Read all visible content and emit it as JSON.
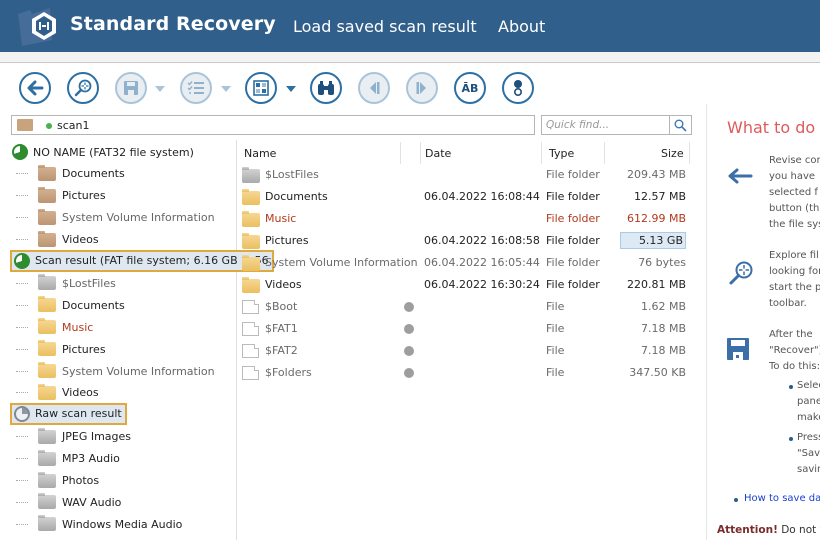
{
  "header": {
    "app_title": "Standard Recovery",
    "nav": [
      {
        "label": "Load saved scan result"
      },
      {
        "label": "About"
      }
    ]
  },
  "toolbar": {
    "buttons": [
      {
        "name": "back",
        "icon": "arrow-left-icon",
        "enabled": true
      },
      {
        "name": "scan",
        "icon": "magnifier-crosshair-icon",
        "enabled": true
      },
      {
        "name": "save",
        "icon": "floppy-disk-icon",
        "enabled": false,
        "has_dropdown": true
      },
      {
        "name": "checklist",
        "icon": "checklist-icon",
        "enabled": false,
        "has_dropdown": true
      },
      {
        "name": "view-mode",
        "icon": "grid-view-icon",
        "enabled": true,
        "has_dropdown": true
      },
      {
        "name": "find",
        "icon": "binoculars-icon",
        "enabled": true
      },
      {
        "name": "previous",
        "icon": "step-back-icon",
        "enabled": false
      },
      {
        "name": "next",
        "icon": "step-forward-icon",
        "enabled": false
      },
      {
        "name": "encoding",
        "icon": "charset-icon",
        "label": "ĀB",
        "enabled": true
      },
      {
        "name": "info",
        "icon": "info-icon",
        "enabled": true
      }
    ]
  },
  "path_bar": {
    "value": "scan1"
  },
  "search": {
    "placeholder": "Quick find..."
  },
  "tree": {
    "items": [
      {
        "label": "NO NAME (FAT32 file system)",
        "type": "root",
        "icon": "scan-pie-icon"
      },
      {
        "label": "Documents",
        "type": "folder",
        "color": "brown",
        "style": "normal"
      },
      {
        "label": "Pictures",
        "type": "folder",
        "color": "brown",
        "style": "normal"
      },
      {
        "label": "System Volume Information",
        "type": "folder",
        "color": "brown",
        "style": "muted"
      },
      {
        "label": "Videos",
        "type": "folder",
        "color": "brown",
        "style": "normal"
      },
      {
        "label": "Scan result (FAT file system; 6.16 GB in 56",
        "type": "root",
        "icon": "scan-pie-icon",
        "highlight": true
      },
      {
        "label": "$LostFiles",
        "type": "folder",
        "color": "grey",
        "style": "muted"
      },
      {
        "label": "Documents",
        "type": "folder",
        "color": "yellow",
        "style": "normal"
      },
      {
        "label": "Music",
        "type": "folder",
        "color": "yellow",
        "style": "red"
      },
      {
        "label": "Pictures",
        "type": "folder",
        "color": "yellow",
        "style": "normal"
      },
      {
        "label": "System Volume Information",
        "type": "folder",
        "color": "yellow",
        "style": "muted"
      },
      {
        "label": "Videos",
        "type": "folder",
        "color": "yellow",
        "style": "normal"
      },
      {
        "label": "Raw scan result",
        "type": "root",
        "icon": "raw-pie-icon",
        "highlight": true
      },
      {
        "label": "JPEG Images",
        "type": "folder",
        "color": "grey",
        "style": "normal"
      },
      {
        "label": "MP3 Audio",
        "type": "folder",
        "color": "grey",
        "style": "normal"
      },
      {
        "label": "Photos",
        "type": "folder",
        "color": "grey",
        "style": "normal"
      },
      {
        "label": "WAV Audio",
        "type": "folder",
        "color": "grey",
        "style": "normal"
      },
      {
        "label": "Windows Media Audio",
        "type": "folder",
        "color": "grey",
        "style": "normal"
      }
    ]
  },
  "file_list": {
    "columns": [
      "Name",
      "Date",
      "Type",
      "Size"
    ],
    "rows": [
      {
        "name": "$LostFiles",
        "date": "",
        "type": "File folder",
        "size": "209.43 MB",
        "kind": "folder-grey",
        "style": "muted"
      },
      {
        "name": "Documents",
        "date": "06.04.2022 16:08:44",
        "type": "File folder",
        "size": "12.57 MB",
        "kind": "folder",
        "style": "normal"
      },
      {
        "name": "Music",
        "date": "",
        "type": "File folder",
        "size": "612.99 MB",
        "kind": "folder",
        "style": "red"
      },
      {
        "name": "Pictures",
        "date": "06.04.2022 16:08:58",
        "type": "File folder",
        "size": "5.13 GB",
        "kind": "folder",
        "style": "normal",
        "size_selected": true
      },
      {
        "name": "System Volume Information",
        "date": "06.04.2022 16:05:44",
        "type": "File folder",
        "size": "76 bytes",
        "kind": "folder",
        "style": "muted"
      },
      {
        "name": "Videos",
        "date": "06.04.2022 16:30:24",
        "type": "File folder",
        "size": "220.81 MB",
        "kind": "folder",
        "style": "normal"
      },
      {
        "name": "$Boot",
        "date": "",
        "type": "File",
        "size": "1.62 MB",
        "kind": "file",
        "style": "muted",
        "deleted_marker": true
      },
      {
        "name": "$FAT1",
        "date": "",
        "type": "File",
        "size": "7.18 MB",
        "kind": "file",
        "style": "muted",
        "deleted_marker": true
      },
      {
        "name": "$FAT2",
        "date": "",
        "type": "File",
        "size": "7.18 MB",
        "kind": "file",
        "style": "muted",
        "deleted_marker": true
      },
      {
        "name": "$Folders",
        "date": "",
        "type": "File",
        "size": "347.50 KB",
        "kind": "file",
        "style": "muted",
        "deleted_marker": true
      }
    ]
  },
  "help_panel": {
    "title": "What to do n",
    "sections": [
      {
        "icon": "arrow-left-icon",
        "lines": [
          "Revise cor",
          "you  have",
          "selected  f",
          "button (th",
          "the file sys"
        ]
      },
      {
        "icon": "magnifier-crosshair-icon",
        "lines": [
          "Explore  fil",
          "looking for",
          "start  the  p",
          "toolbar."
        ]
      },
      {
        "icon": "floppy-disk-icon",
        "lines": [
          "After  the",
          "\"Recover\")",
          "To do this:"
        ]
      }
    ],
    "bullets": [
      {
        "lines": [
          "Selec",
          "pane",
          "make"
        ]
      },
      {
        "lines": [
          "Press",
          "\"Sav",
          "savin"
        ]
      }
    ],
    "link": "How to save dat",
    "attention_label": "Attention!",
    "attention_text": " Do not t"
  },
  "colors": {
    "header_bg": "#2f5f8a",
    "accent": "#2d6fa3",
    "highlight_border": "#e0a93e",
    "deleted_red": "#b23a1c",
    "help_title": "#e05a5a"
  }
}
